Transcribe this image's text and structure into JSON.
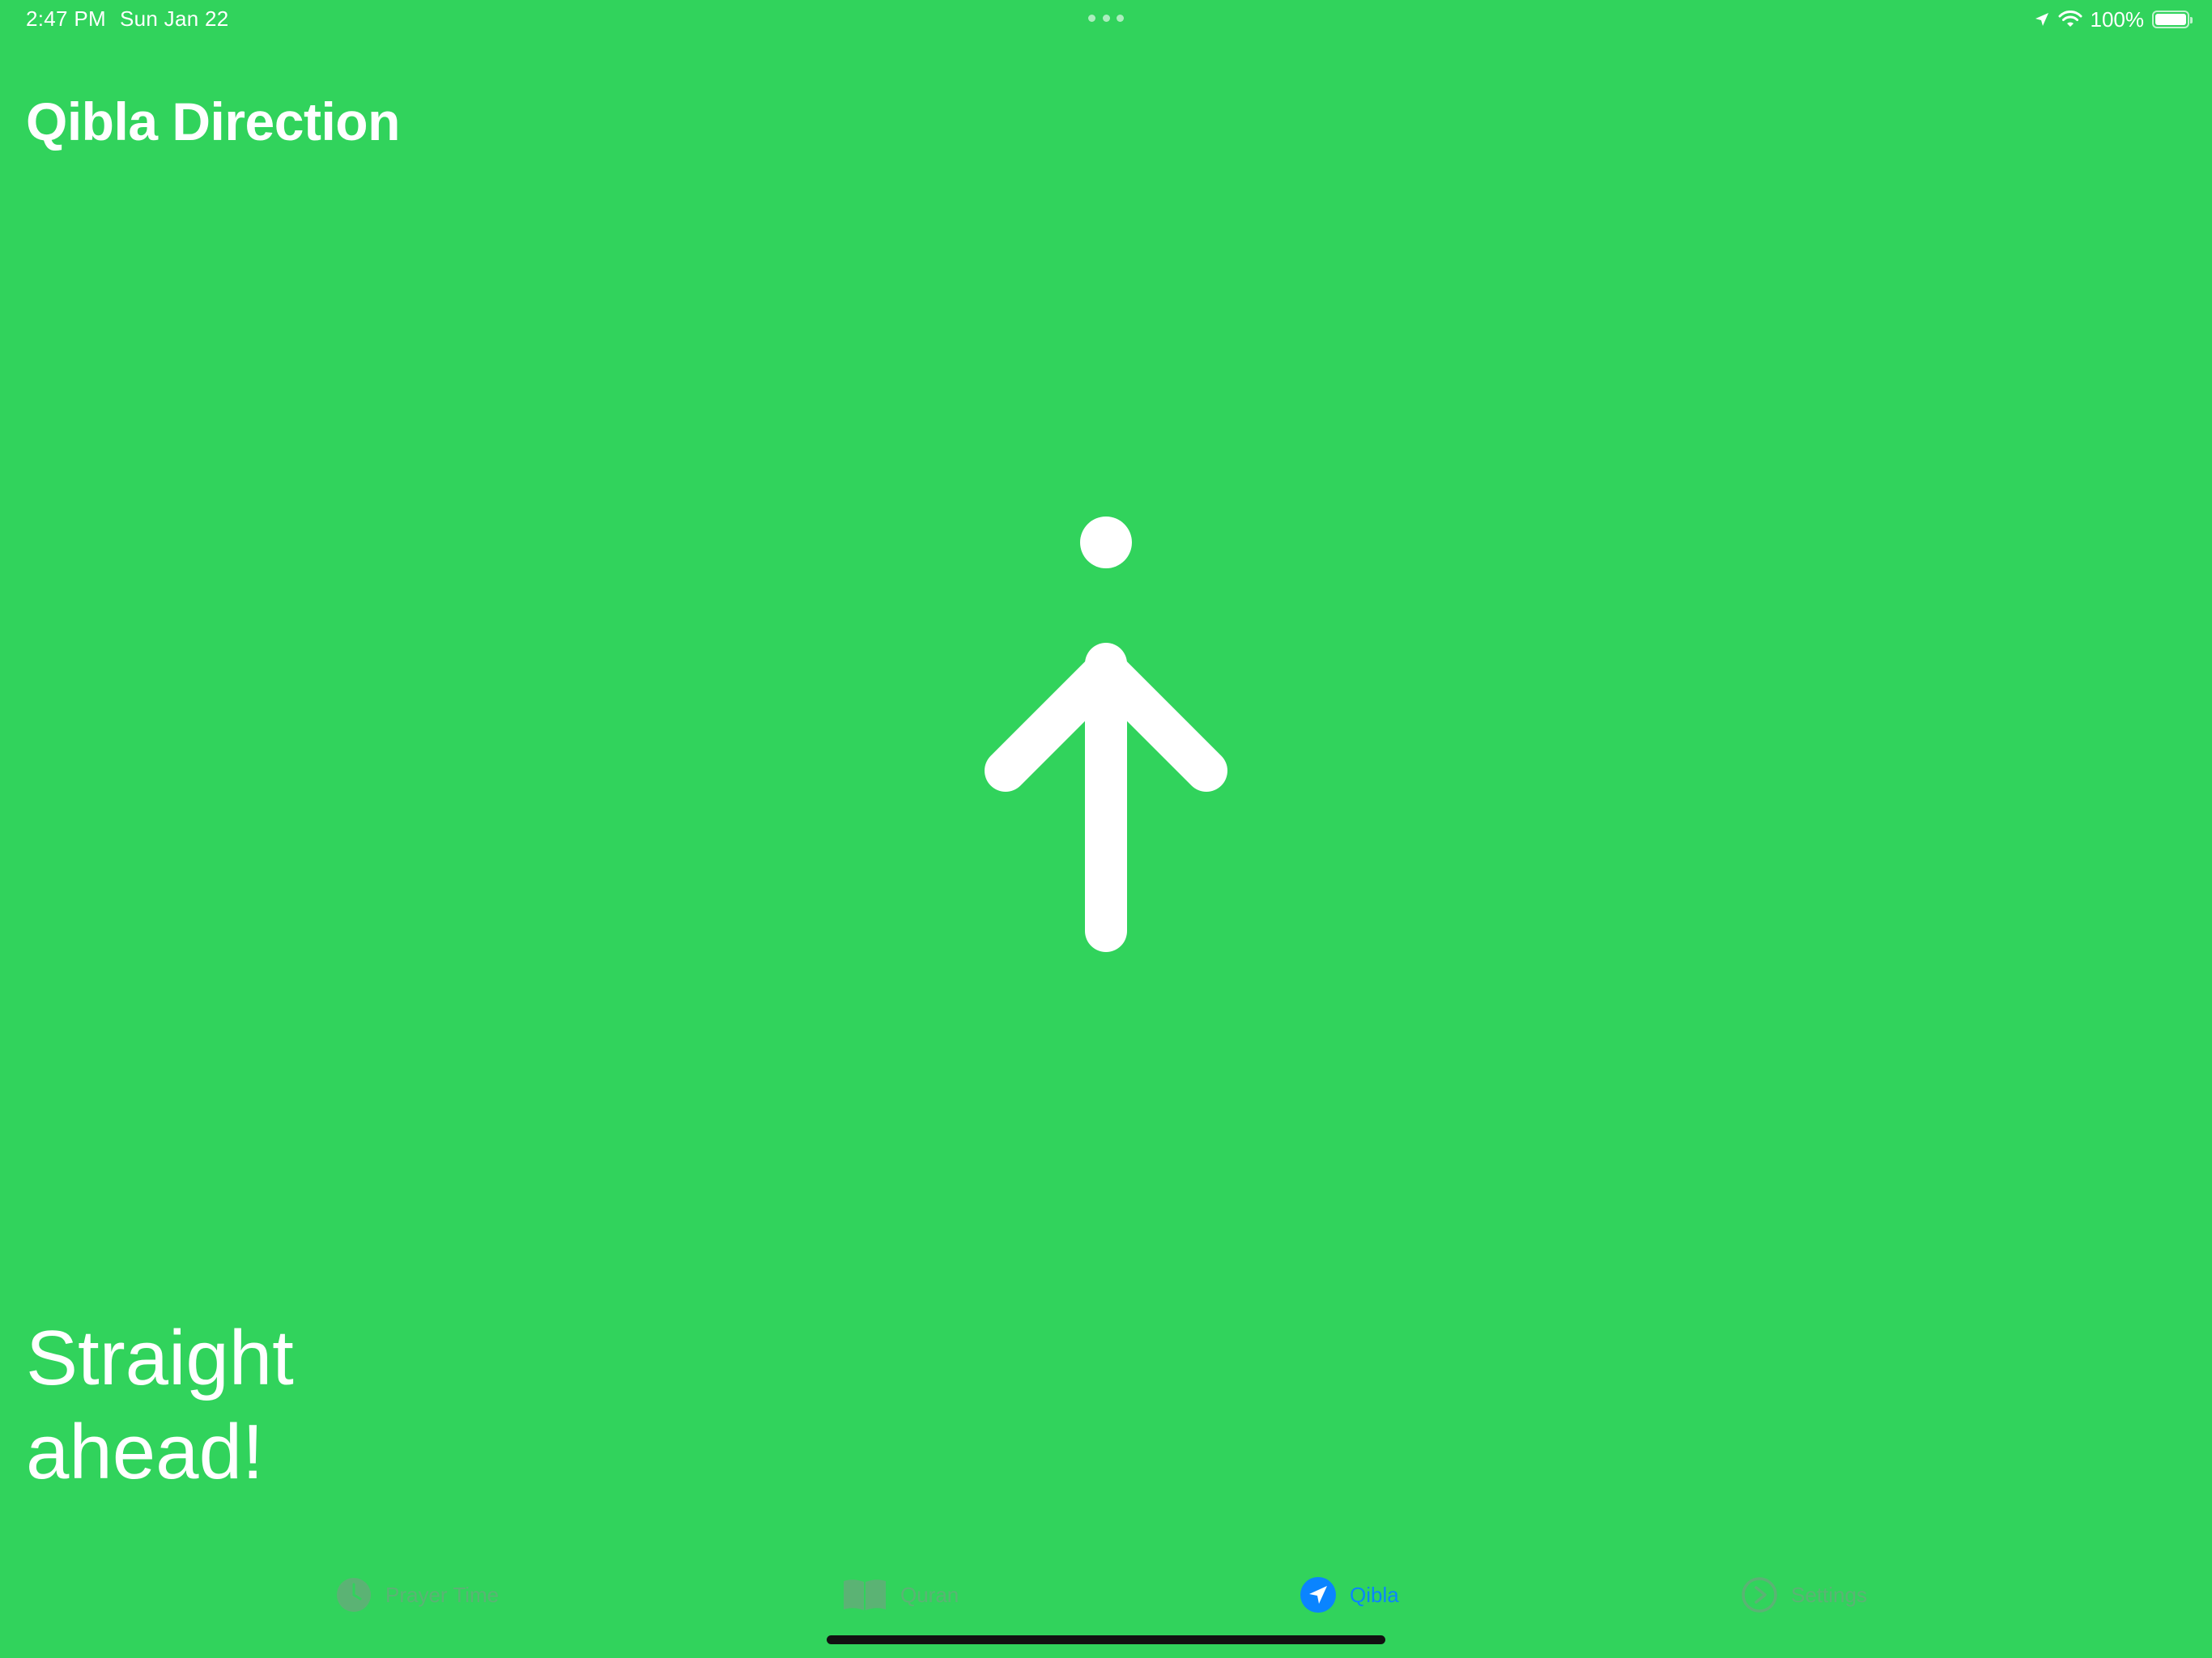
{
  "status_bar": {
    "time": "2:47 PM",
    "date": "Sun Jan 22",
    "battery_percent": "100%",
    "battery_level": 1.0
  },
  "header": {
    "title": "Qibla Direction"
  },
  "main": {
    "direction_text": "Straight ahead!",
    "arrow_icon": "arrow-up-icon"
  },
  "tab_bar": {
    "tabs": [
      {
        "label": "Prayer Time",
        "icon": "clock-icon",
        "active": false
      },
      {
        "label": "Quran",
        "icon": "book-icon",
        "active": false
      },
      {
        "label": "Qibla",
        "icon": "location-arrow-icon",
        "active": true
      },
      {
        "label": "Settings",
        "icon": "gear-icon",
        "active": false
      }
    ]
  },
  "colors": {
    "background": "#31D35C",
    "foreground": "#FFFFFF",
    "tab_active": "#0A84FF",
    "tab_inactive": "#8E8E93"
  }
}
